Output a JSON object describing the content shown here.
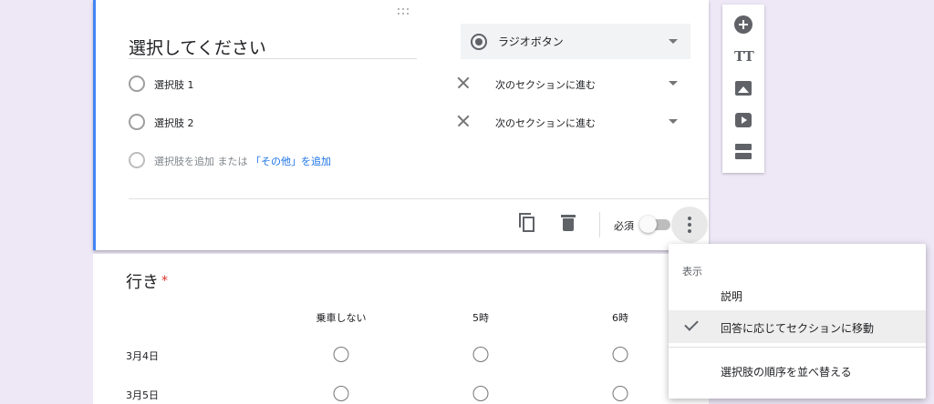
{
  "question_card": {
    "title": "選択してください",
    "type_selector": {
      "selected": "ラジオボタン",
      "icon": "radio-button-checked-icon"
    },
    "options": [
      {
        "label": "選択肢 1",
        "goto": "次のセクションに進む"
      },
      {
        "label": "選択肢 2",
        "goto": "次のセクションに進む"
      }
    ],
    "add_option": {
      "prefix": "選択肢を追加",
      "or": "または",
      "add_other": "「その他」を追加"
    },
    "footer": {
      "copy_icon": "content-copy-icon",
      "delete_icon": "trash-icon",
      "required_label": "必須",
      "required_on": false,
      "more_icon": "more-vert-icon"
    }
  },
  "side_toolbar": {
    "items": [
      {
        "icon": "add-circle-icon"
      },
      {
        "icon": "title-text-icon",
        "glyph": "TT"
      },
      {
        "icon": "image-icon"
      },
      {
        "icon": "video-icon"
      },
      {
        "icon": "section-icon"
      }
    ]
  },
  "grid_question": {
    "title": "行き",
    "required_mark": "*",
    "columns": [
      "乗車しない",
      "5時",
      "6時"
    ],
    "rows": [
      "3月4日",
      "3月5日"
    ]
  },
  "context_menu": {
    "header": "表示",
    "items": [
      {
        "label": "説明",
        "checked": false
      },
      {
        "label": "回答に応じてセクションに移動",
        "checked": true
      },
      {
        "label": "選択肢の順序を並べ替える",
        "checked": false
      }
    ]
  },
  "colors": {
    "background": "#ede7f6",
    "accent_blue": "#4285f4",
    "link_blue": "#1a73e8",
    "required_red": "#d93025"
  }
}
